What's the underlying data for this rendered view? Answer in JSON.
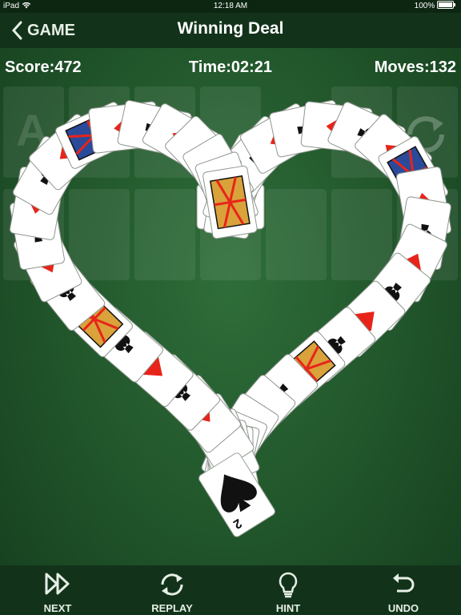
{
  "status_bar": {
    "device": "iPad",
    "time": "12:18 AM",
    "battery": "100%"
  },
  "nav": {
    "back_label": "GAME",
    "title": "Winning Deal"
  },
  "stats": {
    "score": "Score:472",
    "time": "Time:02:21",
    "moves": "Moves:132"
  },
  "foundation_placeholder": "A",
  "cards": {
    "front_card_rank": "2",
    "front_card_suit": "spade",
    "red_suit": "diamond",
    "black_suit": "club"
  },
  "toolbar": {
    "next": "NEXT",
    "replay": "REPLAY",
    "hint": "HINT",
    "undo": "UNDO"
  },
  "colors": {
    "felt": "#23592d",
    "bar": "#12331a",
    "red": "#e8241a",
    "black": "#111111"
  },
  "icons": [
    "chevron-left-icon",
    "wifi-icon",
    "battery-icon",
    "recycle-icon",
    "fast-forward-icon",
    "replay-icon",
    "lightbulb-icon",
    "undo-icon"
  ]
}
